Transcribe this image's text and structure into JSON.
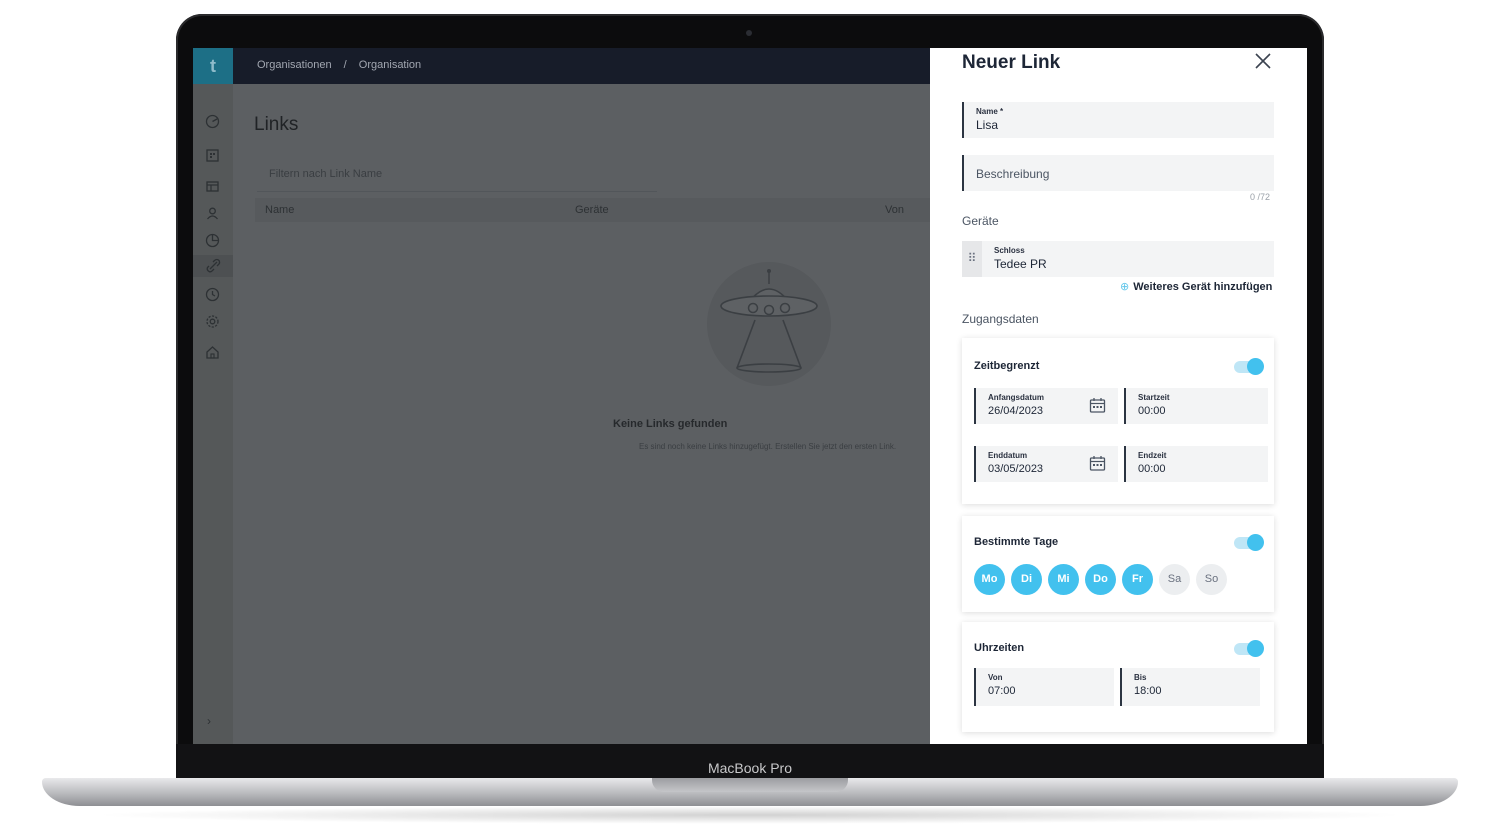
{
  "device": {
    "bezel_label": "MacBook Pro"
  },
  "app": {
    "logo": "t",
    "breadcrumb": [
      "Organisationen",
      "/",
      "Organisation"
    ],
    "page_title": "Links",
    "filter_placeholder": "Filtern nach Link Name",
    "table_headers": [
      "Name",
      "Geräte",
      "Von"
    ],
    "empty_title": "Keine Links gefunden",
    "empty_text": "Es sind noch keine Links hinzugefügt. Erstellen Sie jetzt den ersten Link.",
    "sidebar_icons": [
      "dashboard-icon",
      "building-icon",
      "table-icon",
      "user-icon",
      "chart-icon",
      "link-icon",
      "clock-icon",
      "gear-icon",
      "home-icon"
    ]
  },
  "panel": {
    "title": "Neuer Link",
    "name_field": {
      "label": "Name *",
      "value": "Lisa"
    },
    "description_field": {
      "placeholder": "Beschreibung",
      "counter": "0 /72"
    },
    "devices_label": "Geräte",
    "device": {
      "label": "Schloss",
      "value": "Tedee PR"
    },
    "add_device_label": "Weiteres Gerät hinzufügen",
    "access_label": "Zugangsdaten",
    "time_limited": {
      "title": "Zeitbegrenzt",
      "enabled": true,
      "start_date_label": "Anfangsdatum",
      "start_date": "26/04/2023",
      "start_time_label": "Startzeit",
      "start_time": "00:00",
      "end_date_label": "Enddatum",
      "end_date": "03/05/2023",
      "end_time_label": "Endzeit",
      "end_time": "00:00"
    },
    "specific_days": {
      "title": "Bestimmte Tage",
      "enabled": true,
      "days": [
        {
          "label": "Mo",
          "on": true
        },
        {
          "label": "Di",
          "on": true
        },
        {
          "label": "Mi",
          "on": true
        },
        {
          "label": "Do",
          "on": true
        },
        {
          "label": "Fr",
          "on": true
        },
        {
          "label": "Sa",
          "on": false
        },
        {
          "label": "So",
          "on": false
        }
      ]
    },
    "hours": {
      "title": "Uhrzeiten",
      "enabled": true,
      "from_label": "Von",
      "from": "07:00",
      "to_label": "Bis",
      "to": "18:00"
    },
    "accent_color": "#42c1ee"
  }
}
